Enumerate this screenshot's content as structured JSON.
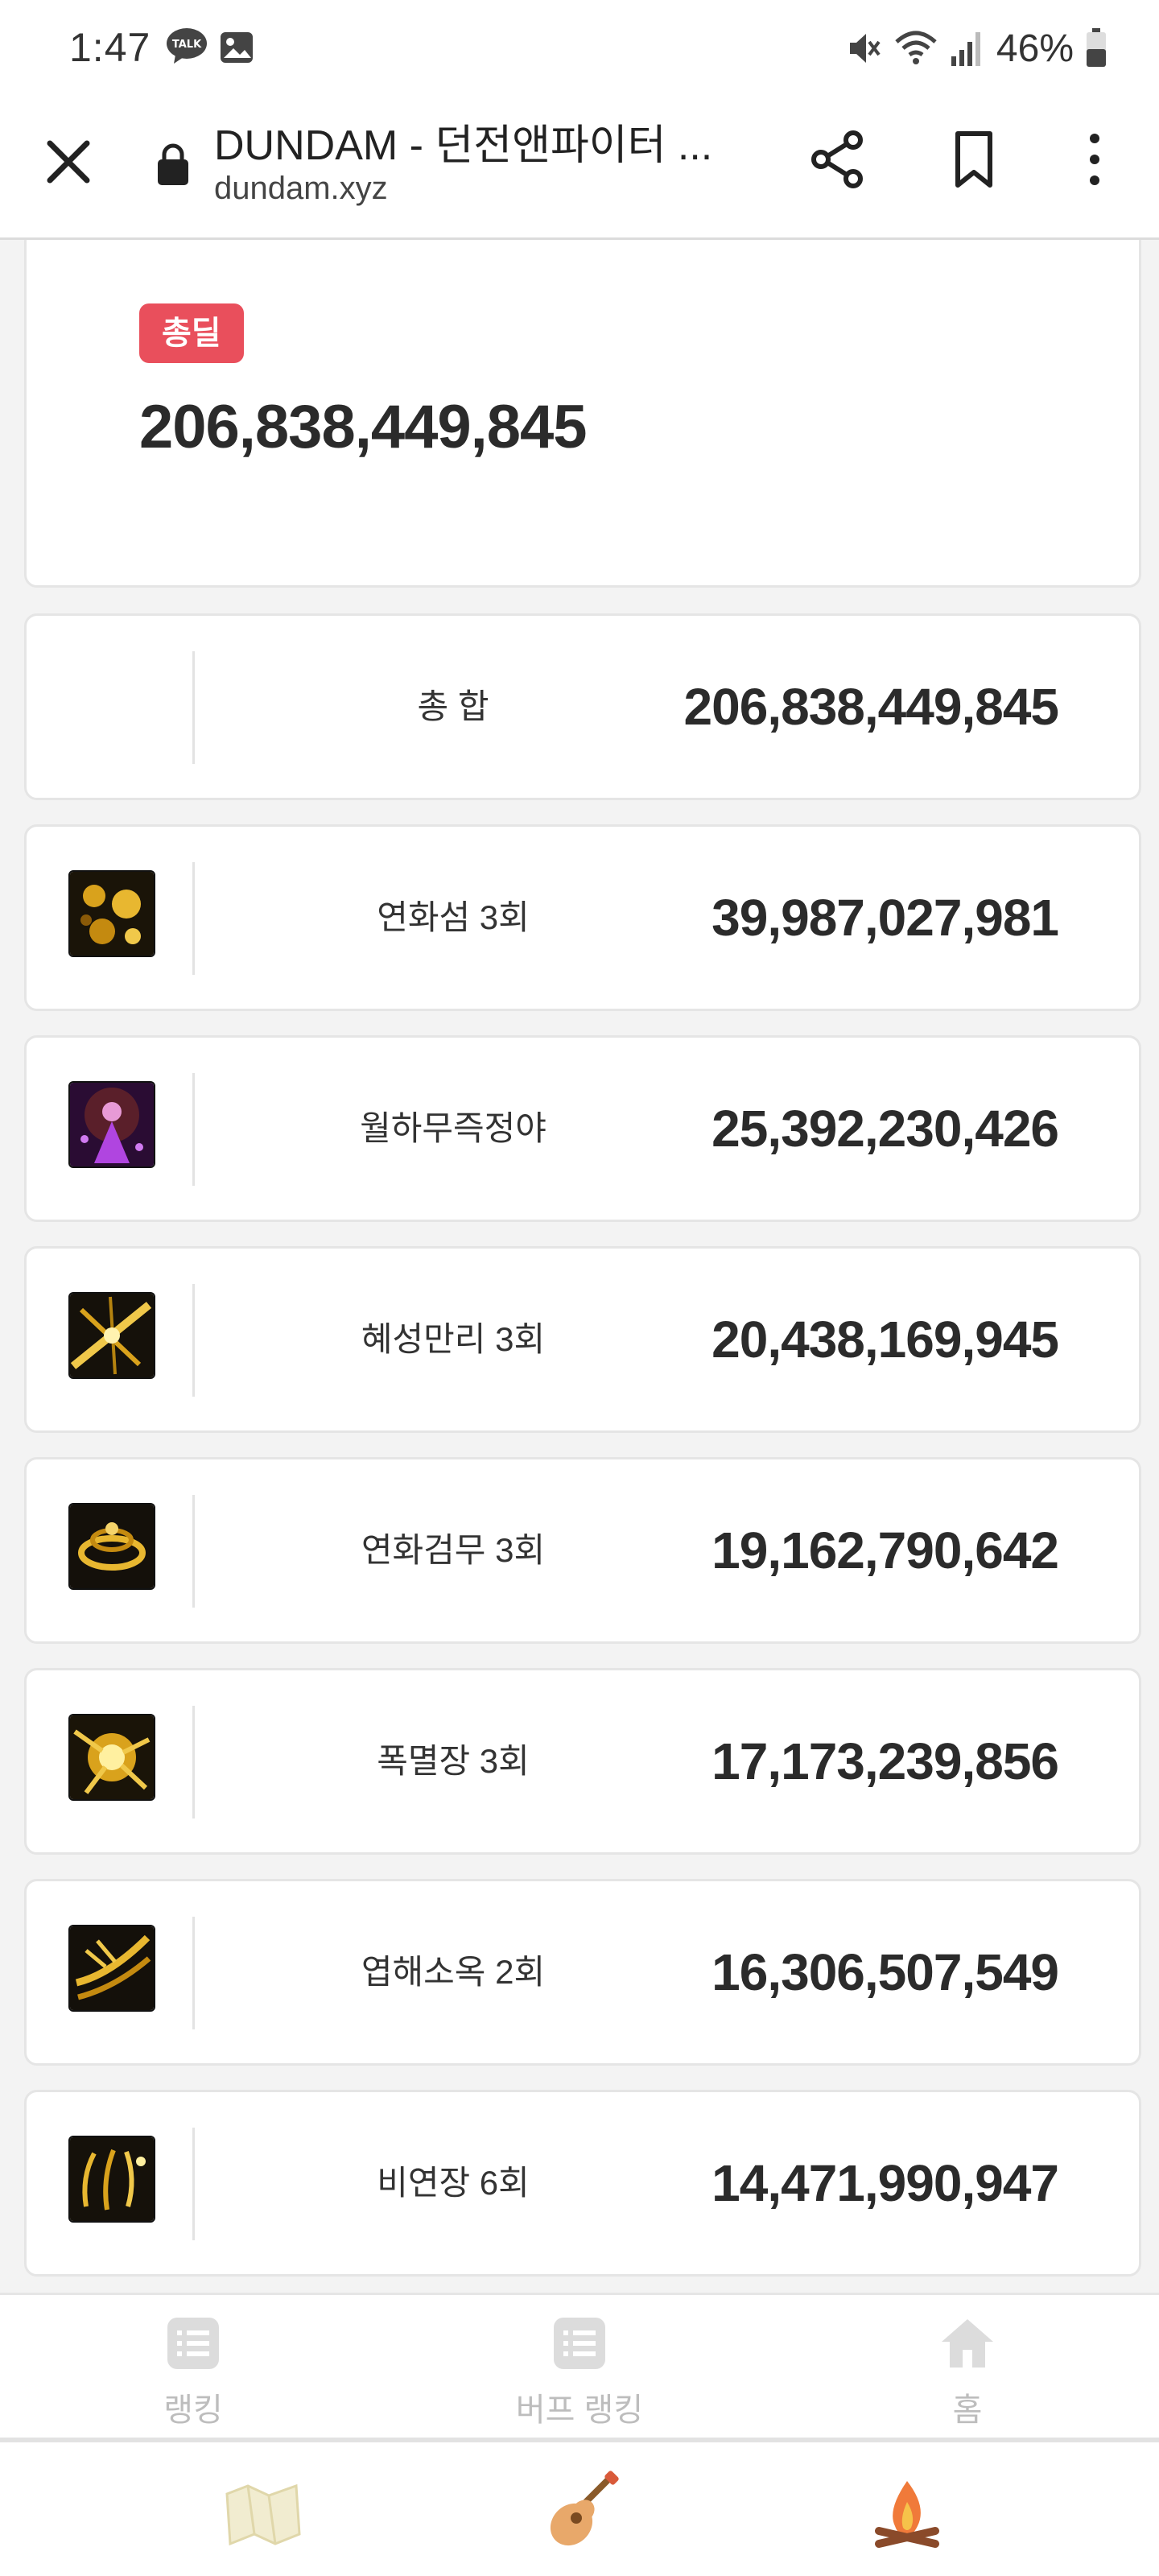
{
  "status_bar": {
    "time": "1:47",
    "talk_badge": "TALK",
    "battery": "46%"
  },
  "browser": {
    "title": "DUNDAM - 던전앤파이터 ...",
    "url": "dundam.xyz"
  },
  "total": {
    "badge": "총딜",
    "value": "206,838,449,845"
  },
  "summary_row": {
    "label": "총 합",
    "value": "206,838,449,845"
  },
  "skills": [
    {
      "name": "연화섬 3회",
      "value": "39,987,027,981",
      "icon": "skill-icon-gold-burst"
    },
    {
      "name": "월하무즉정야",
      "value": "25,392,230,426",
      "icon": "skill-icon-purple-figure"
    },
    {
      "name": "혜성만리 3회",
      "value": "20,438,169,945",
      "icon": "skill-icon-gold-slash"
    },
    {
      "name": "연화검무 3회",
      "value": "19,162,790,642",
      "icon": "skill-icon-gold-swirl"
    },
    {
      "name": "폭멸장 3회",
      "value": "17,173,239,856",
      "icon": "skill-icon-gold-explosion"
    },
    {
      "name": "엽해소옥 2회",
      "value": "16,306,507,549",
      "icon": "skill-icon-gold-claw"
    },
    {
      "name": "비연장 6회",
      "value": "14,471,990,947",
      "icon": "skill-icon-gold-sparks"
    }
  ],
  "bottom_nav": [
    {
      "label": "랭킹",
      "icon": "list-icon"
    },
    {
      "label": "버프 랭킹",
      "icon": "list-icon"
    },
    {
      "label": "홈",
      "icon": "home-icon"
    }
  ],
  "gesture_bar": [
    {
      "icon": "map-icon"
    },
    {
      "icon": "guitar-icon"
    },
    {
      "icon": "campfire-icon"
    }
  ],
  "colors": {
    "badge": "#e94f5c",
    "icon_gold": "#e0a81c",
    "icon_purple": "#9b3fd1"
  }
}
